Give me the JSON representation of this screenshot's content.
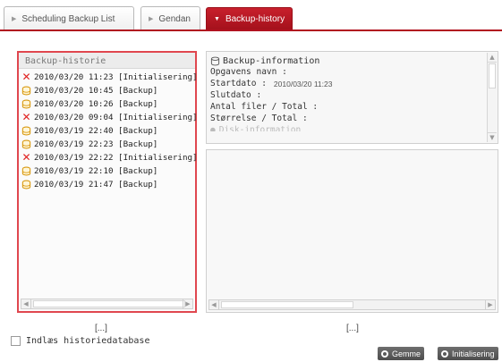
{
  "tabs": [
    {
      "label": "Scheduling Backup List",
      "active": false
    },
    {
      "label": "Gendan",
      "active": false
    },
    {
      "label": "Backup-history",
      "active": true
    }
  ],
  "history": {
    "title": "Backup-historie",
    "rows": [
      {
        "icon": "error-x-icon",
        "text": "2010/03/20 11:23 [Initialisering]"
      },
      {
        "icon": "database-icon",
        "text": "2010/03/20 10:45 [Backup]"
      },
      {
        "icon": "database-icon",
        "text": "2010/03/20 10:26 [Backup]"
      },
      {
        "icon": "error-x-icon",
        "text": "2010/03/20 09:04 [Initialisering]"
      },
      {
        "icon": "database-icon",
        "text": "2010/03/19 22:40 [Backup]"
      },
      {
        "icon": "database-icon",
        "text": "2010/03/19 22:23 [Backup]"
      },
      {
        "icon": "error-x-icon",
        "text": "2010/03/19 22:22 [Initialisering]"
      },
      {
        "icon": "database-icon",
        "text": "2010/03/19 22:10 [Backup]"
      },
      {
        "icon": "database-icon",
        "text": "2010/03/19 21:47 [Backup]"
      }
    ],
    "more": "[...]"
  },
  "info": {
    "title": "Backup-information",
    "fields": [
      {
        "label": "Opgavens navn :",
        "value": ""
      },
      {
        "label": "Startdato :",
        "value": "2010/03/20 11:23"
      },
      {
        "label": "Slutdato :",
        "value": ""
      },
      {
        "label": "Antal filer / Total :",
        "value": ""
      },
      {
        "label": "Størrelse / Total :",
        "value": ""
      }
    ],
    "cut_row": "Disk-information"
  },
  "detail": {
    "more": "[...]"
  },
  "load_history_label": "Indlæs historiedatabase",
  "buttons": {
    "save": "Gemme",
    "init": "Initialisering"
  },
  "colors": {
    "accent": "#b1121f",
    "error": "#e0201f",
    "db_icon": "#d99a12"
  }
}
